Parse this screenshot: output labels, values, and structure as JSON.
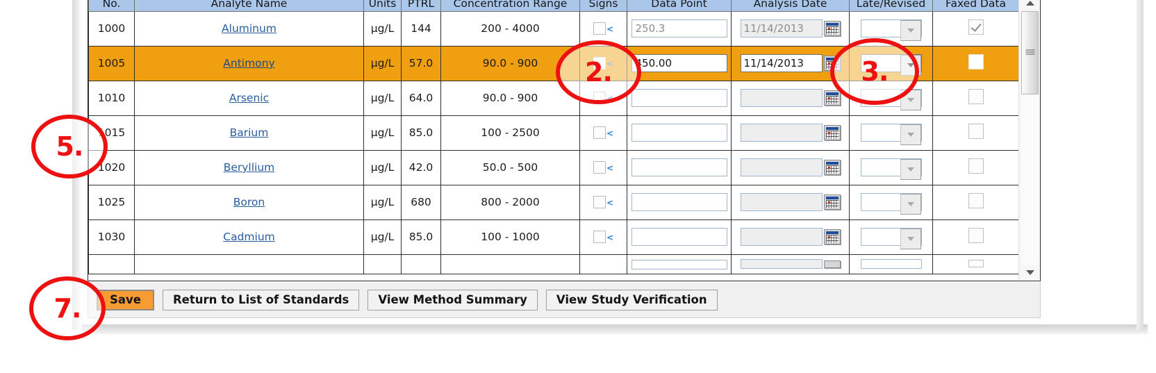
{
  "table": {
    "headers": [
      "No.",
      "Analyte Name",
      "Units",
      "PTRL",
      "Concentration Range",
      "Signs",
      "Data Point",
      "Analysis Date",
      "Late/Revised",
      "Faxed Data"
    ],
    "rows": [
      {
        "no": "1000",
        "analyte": "Aluminum",
        "units": "µg/L",
        "ptrl": "144",
        "range": "200 - 4000",
        "sign_lt": "<",
        "data_point": "250.3",
        "analysis_date": "11/14/2013",
        "late_revised": "",
        "faxed": true,
        "selected": false
      },
      {
        "no": "1005",
        "analyte": "Antimony",
        "units": "µg/L",
        "ptrl": "57.0",
        "range": "90.0 - 900",
        "sign_lt": "<",
        "data_point": "450.00",
        "analysis_date": "11/14/2013",
        "late_revised": "",
        "faxed": false,
        "selected": true
      },
      {
        "no": "1010",
        "analyte": "Arsenic",
        "units": "µg/L",
        "ptrl": "64.0",
        "range": "90.0 - 900",
        "sign_lt": "<",
        "data_point": "",
        "analysis_date": "",
        "late_revised": "",
        "faxed": false,
        "selected": false
      },
      {
        "no": "1015",
        "analyte": "Barium",
        "units": "µg/L",
        "ptrl": "85.0",
        "range": "100 - 2500",
        "sign_lt": "<",
        "data_point": "",
        "analysis_date": "",
        "late_revised": "",
        "faxed": false,
        "selected": false
      },
      {
        "no": "1020",
        "analyte": "Beryllium",
        "units": "µg/L",
        "ptrl": "42.0",
        "range": "50.0 - 500",
        "sign_lt": "<",
        "data_point": "",
        "analysis_date": "",
        "late_revised": "",
        "faxed": false,
        "selected": false
      },
      {
        "no": "1025",
        "analyte": "Boron",
        "units": "µg/L",
        "ptrl": "680",
        "range": "800 - 2000",
        "sign_lt": "<",
        "data_point": "",
        "analysis_date": "",
        "late_revised": "",
        "faxed": false,
        "selected": false
      },
      {
        "no": "1030",
        "analyte": "Cadmium",
        "units": "µg/L",
        "ptrl": "85.0",
        "range": "100 - 1000",
        "sign_lt": "<",
        "data_point": "",
        "analysis_date": "",
        "late_revised": "",
        "faxed": false,
        "selected": false
      }
    ]
  },
  "scrollbar": {
    "up_icon": "triangle-up-icon",
    "down_icon": "triangle-down-icon",
    "thumb_grip_icon": "grip-lines-icon"
  },
  "buttons": {
    "save": "Save",
    "return_to_list": "Return to List of Standards",
    "view_method_summary": "View Method Summary",
    "view_study_verification": "View Study Verification"
  },
  "annotations": [
    {
      "id": "ann2",
      "label": "2."
    },
    {
      "id": "ann3",
      "label": "3."
    },
    {
      "id": "ann5",
      "label": "5."
    },
    {
      "id": "ann7",
      "label": "7."
    }
  ],
  "colors": {
    "selected_row": "#ef9f10",
    "header_blue": "#aac7ea",
    "annotation_red": "#ee1111",
    "save_orange": "#f79c32",
    "link_blue": "#2a5d9e"
  }
}
